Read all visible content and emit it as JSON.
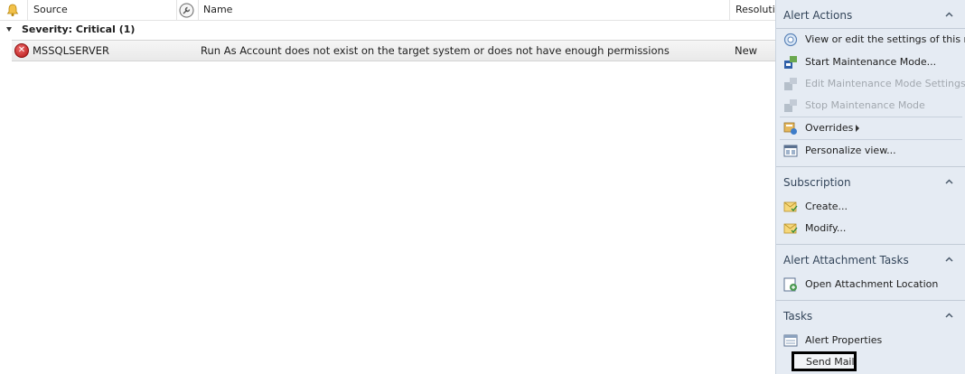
{
  "grid": {
    "columns": {
      "source": "Source",
      "name": "Name",
      "resolution": "Resolutio"
    },
    "group_label": "Severity: Critical (1)",
    "rows": [
      {
        "source": "MSSQLSERVER",
        "name": "Run As Account does not exist on the target system or does not have enough permissions",
        "resolution": "New",
        "severity_icon": "critical-icon"
      }
    ]
  },
  "task_pane": {
    "alert_actions": {
      "title": "Alert Actions",
      "items": [
        {
          "label": "View or edit the settings of this rule",
          "icon": "rule-settings-icon",
          "enabled": true
        },
        {
          "label": "Start Maintenance Mode...",
          "icon": "maintenance-icon",
          "enabled": true
        },
        {
          "label": "Edit Maintenance Mode Settings...",
          "icon": "maintenance-edit-icon",
          "enabled": false
        },
        {
          "label": "Stop Maintenance Mode",
          "icon": "maintenance-stop-icon",
          "enabled": false
        },
        {
          "label": "Overrides",
          "icon": "overrides-icon",
          "enabled": true
        },
        {
          "label": "Personalize view...",
          "icon": "personalize-icon",
          "enabled": true
        }
      ]
    },
    "subscription": {
      "title": "Subscription",
      "items": [
        {
          "label": "Create...",
          "icon": "subscription-create-icon"
        },
        {
          "label": "Modify...",
          "icon": "subscription-modify-icon"
        }
      ]
    },
    "attachment_tasks": {
      "title": "Alert Attachment Tasks",
      "items": [
        {
          "label": "Open Attachment Location",
          "icon": "attachment-location-icon"
        }
      ]
    },
    "tasks": {
      "title": "Tasks",
      "items": [
        {
          "label": "Alert Properties",
          "icon": "properties-icon"
        },
        {
          "label": "Send Mail",
          "icon": ""
        }
      ]
    }
  },
  "colors": {
    "pane_background": "#e5ebf3",
    "disabled_text": "#a2a8af",
    "critical": "#c0392b"
  }
}
